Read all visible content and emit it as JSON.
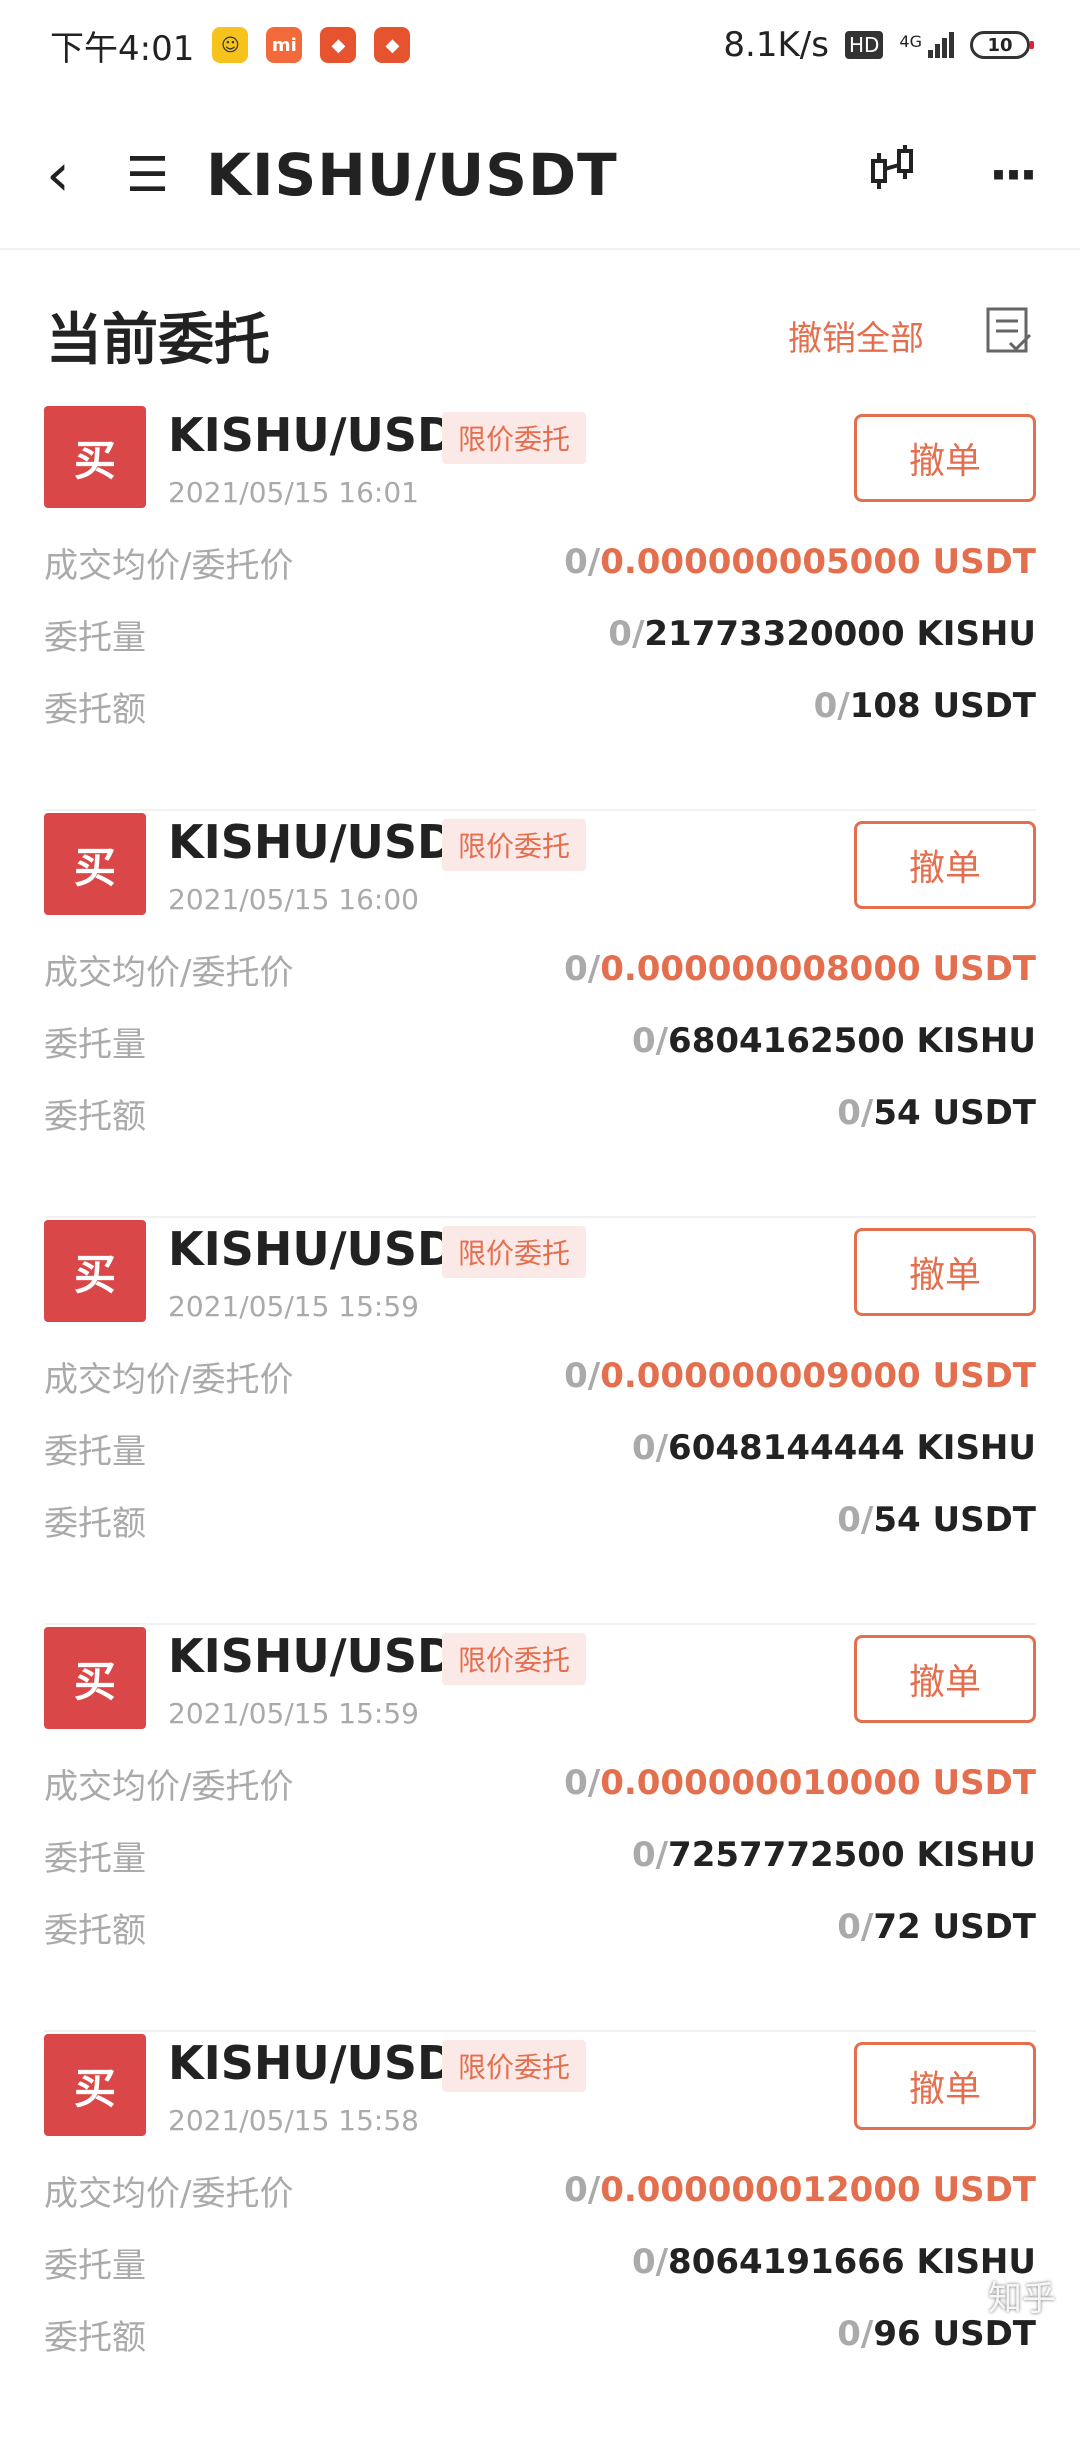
{
  "status_bar": {
    "time": "下午4:01",
    "network_speed": "8.1K/s",
    "hd_label": "HD",
    "signal_label": "4G",
    "battery": "10",
    "app_icons": [
      "smile-app-icon",
      "mi-app-icon",
      "exchange-app-icon",
      "exchange-app-icon"
    ]
  },
  "header": {
    "pair": "KISHU/USDT",
    "back_icon": "‹",
    "menu_icon": "☰",
    "chart_icon": "⧉",
    "more_icon": "···"
  },
  "section": {
    "title": "当前委托",
    "cancel_all": "撤销全部",
    "list_icon": "☷"
  },
  "labels": {
    "avg_price": "成交均价/委托价",
    "amount": "委托量",
    "total": "委托额",
    "cancel": "撤单",
    "buy": "买",
    "type_tag": "限价委托"
  },
  "orders": [
    {
      "symbol": "KISHU/USDT",
      "time": "2021/05/15 16:01",
      "price_filled": "0/",
      "price": "0.000000005000 USDT",
      "amount_filled": "0/",
      "amount": "21773320000 KISHU",
      "total_filled": "0/",
      "total": "108 USDT"
    },
    {
      "symbol": "KISHU/USDT",
      "time": "2021/05/15 16:00",
      "price_filled": "0/",
      "price": "0.000000008000 USDT",
      "amount_filled": "0/",
      "amount": "6804162500 KISHU",
      "total_filled": "0/",
      "total": "54 USDT"
    },
    {
      "symbol": "KISHU/USDT",
      "time": "2021/05/15 15:59",
      "price_filled": "0/",
      "price": "0.000000009000 USDT",
      "amount_filled": "0/",
      "amount": "6048144444 KISHU",
      "total_filled": "0/",
      "total": "54 USDT"
    },
    {
      "symbol": "KISHU/USDT",
      "time": "2021/05/15 15:59",
      "price_filled": "0/",
      "price": "0.000000010000 USDT",
      "amount_filled": "0/",
      "amount": "7257772500 KISHU",
      "total_filled": "0/",
      "total": "72 USDT"
    },
    {
      "symbol": "KISHU/USDT",
      "time": "2021/05/15 15:58",
      "price_filled": "0/",
      "price": "0.000000012000 USDT",
      "amount_filled": "0/",
      "amount": "8064191666 KISHU",
      "total_filled": "0/",
      "total": "96 USDT"
    }
  ],
  "watermark": "知乎",
  "colors": {
    "accent": "#e46f4e",
    "buy_badge": "#d94748",
    "muted": "#aaaaaa"
  }
}
